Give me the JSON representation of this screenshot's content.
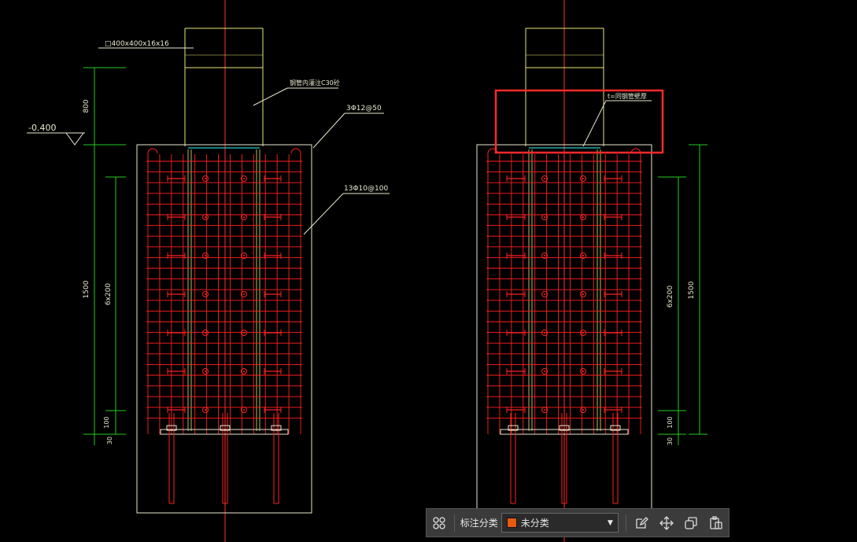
{
  "drawing": {
    "left_detail": {
      "steel_tube_label": "□400x400x16x16",
      "concrete_fill_label": "钢管内灌注C30砼",
      "rebar_top_label": "3Φ12@50",
      "stirrup_label": "13Φ10@100",
      "elevation_label": "-0.400",
      "dims_outer": [
        "800",
        "1500",
        "30"
      ],
      "dims_inner": [
        "6x200",
        "100"
      ]
    },
    "right_detail": {
      "plate_label": "t=同钢管壁厚",
      "dims_outer": [
        "1500"
      ],
      "dims_inner": [
        "6x200",
        "100",
        "30"
      ]
    },
    "colors": {
      "rebar": "#ff2020",
      "outline": "#e8e8d0",
      "column": "#e8e87a",
      "dimension": "#22cc22",
      "highlight": "#ff2a2a",
      "axis": "#ff3030"
    }
  },
  "toolbar": {
    "label": "标注分类",
    "selected_category": "未分类",
    "swatch_color": "#e85a10",
    "icons": [
      "grid-icon",
      "edit-icon",
      "move-icon",
      "copy-icon",
      "paste-icon"
    ]
  }
}
